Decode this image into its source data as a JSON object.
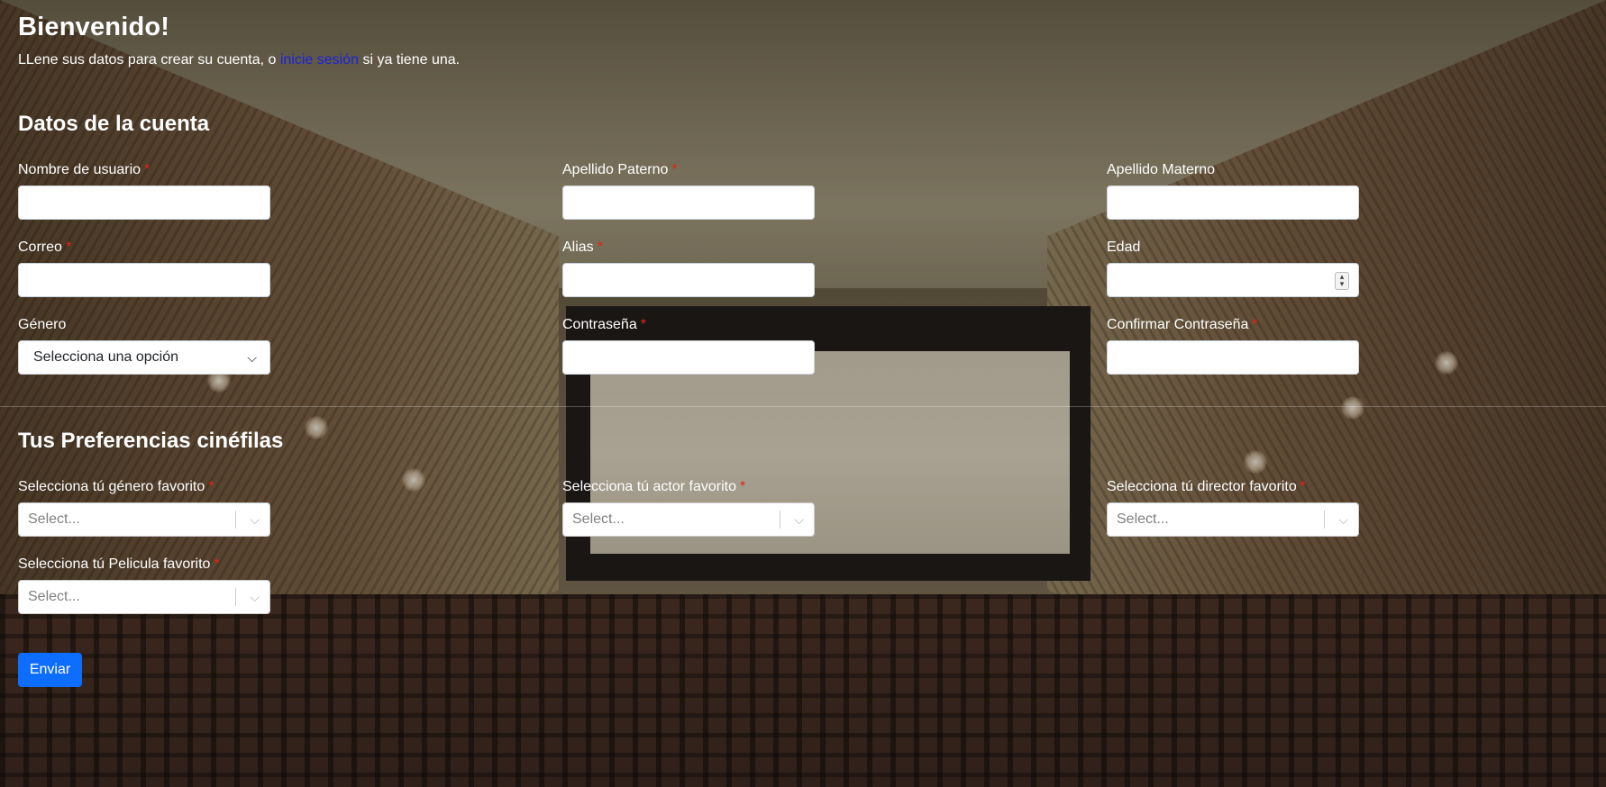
{
  "header": {
    "title": "Bienvenido!",
    "intro_before": "LLene sus datos para crear su cuenta, o ",
    "intro_link": "inicie sesión",
    "intro_after": " si ya tiene una."
  },
  "account_section": {
    "title": "Datos de la cuenta",
    "fields": {
      "username": {
        "label": "Nombre de usuario",
        "required": "*"
      },
      "paternal_surname": {
        "label": "Apellido Paterno",
        "required": "*"
      },
      "maternal_surname": {
        "label": "Apellido Materno"
      },
      "email": {
        "label": "Correo",
        "required": "*"
      },
      "alias": {
        "label": "Alias",
        "required": "*"
      },
      "age": {
        "label": "Edad"
      },
      "gender": {
        "label": "Género",
        "value": "Selecciona una opción"
      },
      "password": {
        "label": "Contraseña",
        "required": "*"
      },
      "confirm_password": {
        "label": "Confirmar Contraseña",
        "required": "*"
      }
    }
  },
  "preferences_section": {
    "title": "Tus Preferencias cinéfilas",
    "fields": {
      "genre": {
        "label": "Selecciona tú género favorito",
        "required": "*",
        "placeholder": "Select..."
      },
      "actor": {
        "label": "Selecciona tú actor favorito",
        "required": "*",
        "placeholder": "Select..."
      },
      "director": {
        "label": "Selecciona tú director favorito",
        "required": "*",
        "placeholder": "Select..."
      },
      "movie": {
        "label": "Selecciona tú Pelicula favorito",
        "required": "*",
        "placeholder": "Select..."
      }
    }
  },
  "submit": {
    "label": "Enviar"
  },
  "icons": {
    "dropdown": "chevron-down-icon",
    "spinner": "number-spinner-icon"
  },
  "colors": {
    "link": "#1a23d8",
    "required": "#e0241c",
    "primary_button": "#0d6efd"
  }
}
